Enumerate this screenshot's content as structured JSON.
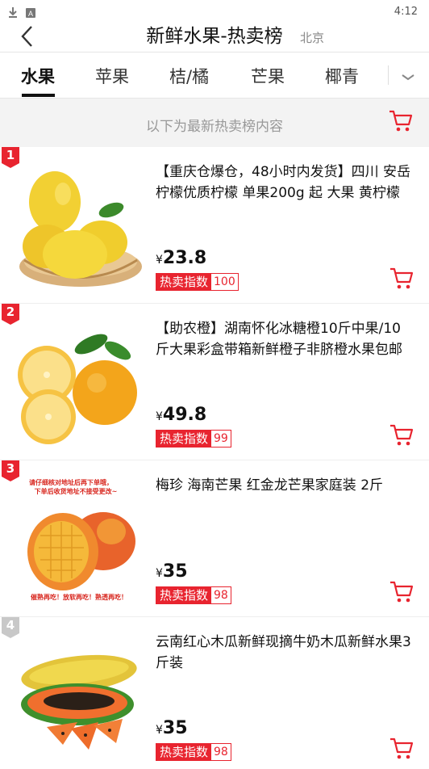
{
  "status_bar": {
    "time": "4:12"
  },
  "header": {
    "title": "新鲜水果-热卖榜",
    "city": "北京"
  },
  "tabs": [
    {
      "label": "水果",
      "active": true
    },
    {
      "label": "苹果",
      "active": false
    },
    {
      "label": "桔/橘",
      "active": false
    },
    {
      "label": "芒果",
      "active": false
    },
    {
      "label": "椰青",
      "active": false
    }
  ],
  "banner": {
    "text": "以下为最新热卖榜内容"
  },
  "hot_label": "热卖指数",
  "currency": "¥",
  "colors": {
    "accent": "#e8242f",
    "rank_top": "#e8242f",
    "rank_other": "#c8c8c8"
  },
  "items": [
    {
      "rank": "1",
      "title": "【重庆仓爆仓，48小时内发货】四川 安岳 柠檬优质柠檬 单果200g 起 大果 黄柠檬",
      "price": "23.8",
      "hot_index": "100",
      "image": "lemon-basket-image",
      "image_caption": []
    },
    {
      "rank": "2",
      "title": "【助农橙】湖南怀化冰糖橙10斤中果/10斤大果彩盒带箱新鲜橙子非脐橙水果包邮",
      "price": "49.8",
      "hot_index": "99",
      "image": "orange-image",
      "image_caption": []
    },
    {
      "rank": "3",
      "title": "梅珍 海南芒果 红金龙芒果家庭装 2斤",
      "price": "35",
      "hot_index": "98",
      "image": "mango-image",
      "image_caption": [
        "请仔细核对地址后再下单哦，",
        "下单后收货地址不接受更改~",
        "催熟再吃！放软再吃！熟透再吃！"
      ]
    },
    {
      "rank": "4",
      "title": "云南红心木瓜新鲜现摘牛奶木瓜新鲜水果3斤装",
      "price": "35",
      "hot_index": "98",
      "image": "papaya-image",
      "image_caption": []
    }
  ]
}
